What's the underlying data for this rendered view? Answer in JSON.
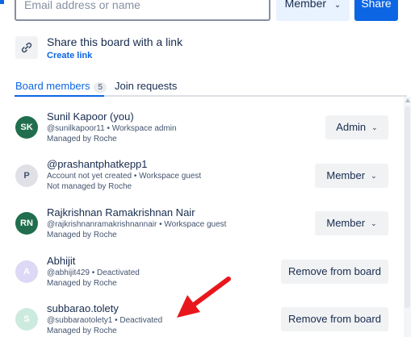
{
  "invite": {
    "email_placeholder": "Email address or name",
    "role_label": "Member",
    "role_chevron": "⌄",
    "share_label": "Share"
  },
  "share_link": {
    "title": "Share this board with a link",
    "create_link_label": "Create link",
    "icon": "link-icon"
  },
  "tabs": {
    "members_label": "Board members",
    "members_count": "5",
    "requests_label": "Join requests"
  },
  "members": [
    {
      "initials": "SK",
      "avatar_color": "#216e4e",
      "name": "Sunil Kapoor (you)",
      "sub": "@sunilkapoor11 • Workspace admin",
      "managed": "Managed by Roche",
      "action": "Admin",
      "chevron": "⌄"
    },
    {
      "initials": "P",
      "avatar_color": "#dfe1e6",
      "initials_color": "#44546f",
      "name": "@prashantphatkepp1",
      "sub": "Account not yet created • Workspace guest",
      "managed": "Not managed by Roche",
      "action": "Member",
      "chevron": "⌄"
    },
    {
      "initials": "RN",
      "avatar_color": "#216e4e",
      "name": "Rajkrishnan Ramakrishnan Nair",
      "sub": "@rajkrishnanramakrishnannair • Workspace guest",
      "managed": "Managed by Roche",
      "action": "Member",
      "chevron": "⌄"
    },
    {
      "initials": "A",
      "avatar_color": "#dcd8f5",
      "initials_color": "#ffffff",
      "name": "Abhijit",
      "sub": "@abhijit429 • Deactivated",
      "managed": "Managed by Roche",
      "action": "Remove from board"
    },
    {
      "initials": "S",
      "avatar_color": "#cdeadf",
      "initials_color": "#ffffff",
      "name": "subbarao.tolety",
      "sub": "@subbaraotolety1 • Deactivated",
      "managed": "Managed by Roche",
      "action": "Remove from board"
    }
  ],
  "colors": {
    "accent": "#0c66e4",
    "annotation_arrow": "#e8171c"
  }
}
